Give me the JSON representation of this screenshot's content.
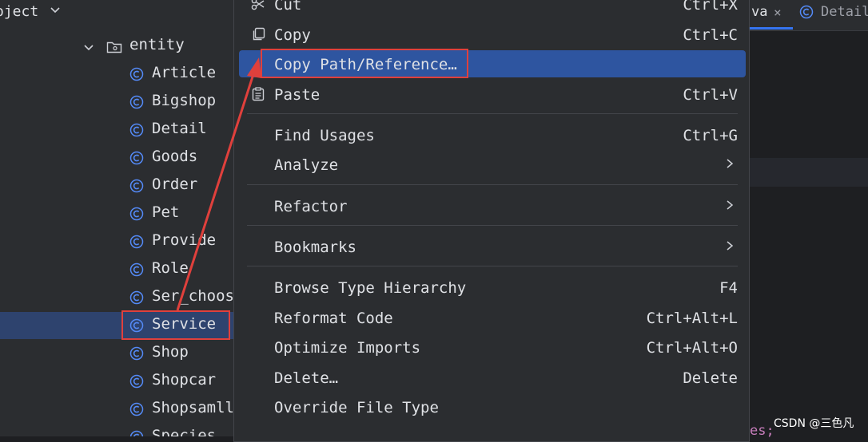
{
  "project": {
    "title": "oject",
    "folder": "entity",
    "items": [
      "Article",
      "Bigshop",
      "Detail",
      "Goods",
      "Order",
      "Pet",
      "Provide",
      "Role",
      "Ser_choos",
      "Service",
      "Shop",
      "Shopcar",
      "Shopsamll",
      "Species"
    ],
    "selected": "Service"
  },
  "editor": {
    "tabs": [
      {
        "label": "va",
        "close": "×"
      },
      {
        "label": "Detail"
      }
    ],
    "code_fragment": "es;"
  },
  "menu": {
    "cut": {
      "label": "Cut",
      "shortcut": "Ctrl+X"
    },
    "copy": {
      "label": "Copy",
      "shortcut": "Ctrl+C"
    },
    "copy_path": {
      "label": "Copy Path/Reference…"
    },
    "paste": {
      "label": "Paste",
      "shortcut": "Ctrl+V"
    },
    "find_usages": {
      "label": "Find Usages",
      "shortcut": "Ctrl+G"
    },
    "analyze": {
      "label": "Analyze"
    },
    "refactor": {
      "label": "Refactor"
    },
    "bookmarks": {
      "label": "Bookmarks"
    },
    "browse_type_hierarchy": {
      "label": "Browse Type Hierarchy",
      "shortcut": "F4"
    },
    "reformat_code": {
      "label": "Reformat Code",
      "shortcut": "Ctrl+Alt+L"
    },
    "optimize_imports": {
      "label": "Optimize Imports",
      "shortcut": "Ctrl+Alt+O"
    },
    "delete": {
      "label": "Delete…",
      "shortcut": "Delete"
    },
    "override_file_type": {
      "label": "Override File Type"
    }
  },
  "watermark": "CSDN @三色凡",
  "colors": {
    "panel_bg": "#2b2d30",
    "selection": "#2e436e",
    "menu_highlight": "#2e55a0",
    "annotation_red": "#e0403c",
    "class_icon_blue": "#548af7"
  }
}
